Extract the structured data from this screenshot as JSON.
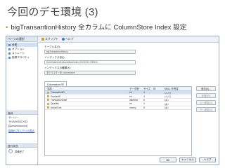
{
  "slide": {
    "title": "今回のデモ環境 (3)",
    "bullet": "bigTransantionHistory 全カラムに ColumnStore Index 設定"
  },
  "left_pane": {
    "header": "ページの選択",
    "nav_items": [
      {
        "label": "全般"
      },
      {
        "label": "オプション"
      },
      {
        "label": "ストレージ"
      },
      {
        "label": "拡張プロパティ"
      }
    ]
  },
  "connection": {
    "header": "接続",
    "server_label": "サーバー:",
    "server": "YKUNO\\SQL2012",
    "login_label": "[Domain\\Account]",
    "link": "接続のプロパティの表示"
  },
  "progress": {
    "header": "進行状況",
    "status": "準備完了"
  },
  "toolbar": {
    "script": "スクリプト",
    "help": "ヘルプ"
  },
  "form": {
    "table_name_label": "テーブル名(T):",
    "table_name": "bigTransactionHistory",
    "index_name_label": "インデックス名(I):",
    "index_name": "NonClusteredColumnStoreIndex-20120211-195944",
    "index_type_label": "インデックスの種類(X):",
    "index_type": "非クラスター化 columnstore"
  },
  "tabs": [
    "Columnstore 列"
  ],
  "grid": {
    "headers": [
      "名前",
      "データ型",
      "サイズ",
      "ID",
      "NULL を許容"
    ],
    "rows": [
      {
        "name": "TransactionID",
        "type": "int",
        "size": "4",
        "id": "",
        "nullable": "いいえ"
      },
      {
        "name": "ProductID",
        "type": "int",
        "size": "4",
        "id": "",
        "nullable": "いいえ"
      },
      {
        "name": "TransactionDate",
        "type": "datetime",
        "size": "8",
        "id": "",
        "nullable": "はい"
      },
      {
        "name": "Quantity",
        "type": "int",
        "size": "4",
        "id": "",
        "nullable": "はい"
      },
      {
        "name": "ActualCost",
        "type": "money",
        "size": "8",
        "id": "",
        "nullable": "はい"
      }
    ]
  },
  "side_buttons": [
    "追加(A)...",
    "削除(R)",
    "上へ移動(U)",
    "下へ移動(D)"
  ],
  "buttons": {
    "ok": "OK",
    "cancel": "キャンセル",
    "help": "ヘルプ"
  }
}
